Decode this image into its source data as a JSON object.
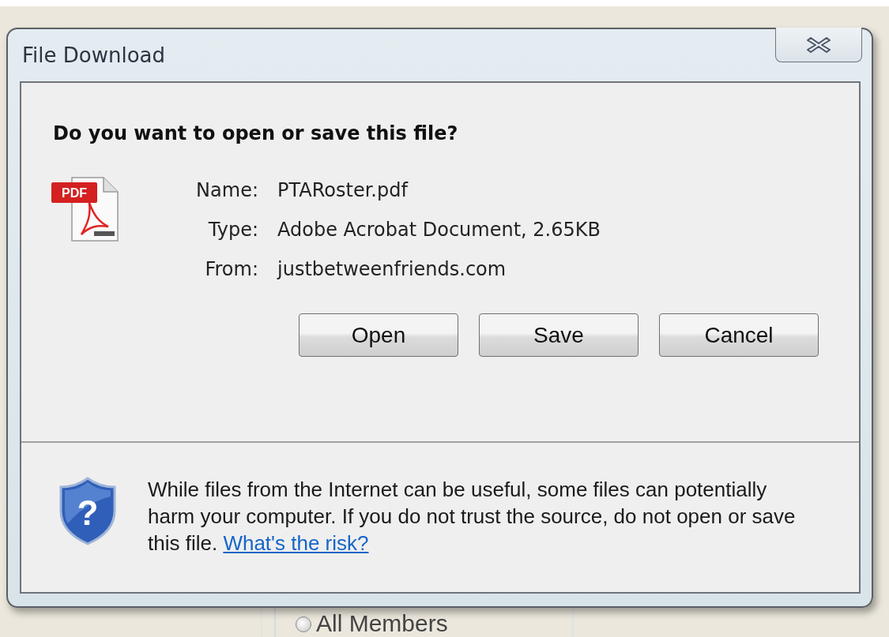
{
  "window": {
    "title": "File Download"
  },
  "question": "Do you want to open or save this file?",
  "file": {
    "icon_label": "PDF",
    "fields": [
      {
        "label": "Name:",
        "value": "PTARoster.pdf"
      },
      {
        "label": "Type:",
        "value": "Adobe Acrobat Document, 2.65KB"
      },
      {
        "label": "From:",
        "value": "justbetweenfriends.com"
      }
    ]
  },
  "buttons": [
    {
      "label": "Open"
    },
    {
      "label": "Save"
    },
    {
      "label": "Cancel"
    }
  ],
  "warning": {
    "icon_glyph": "?",
    "text": "While files from the Internet can be useful, some files can potentially harm your computer. If you do not trust the source, do not open or save this file.",
    "link": "What's the risk?"
  },
  "background": {
    "radio": {
      "label": "All Members",
      "selected": false
    }
  }
}
